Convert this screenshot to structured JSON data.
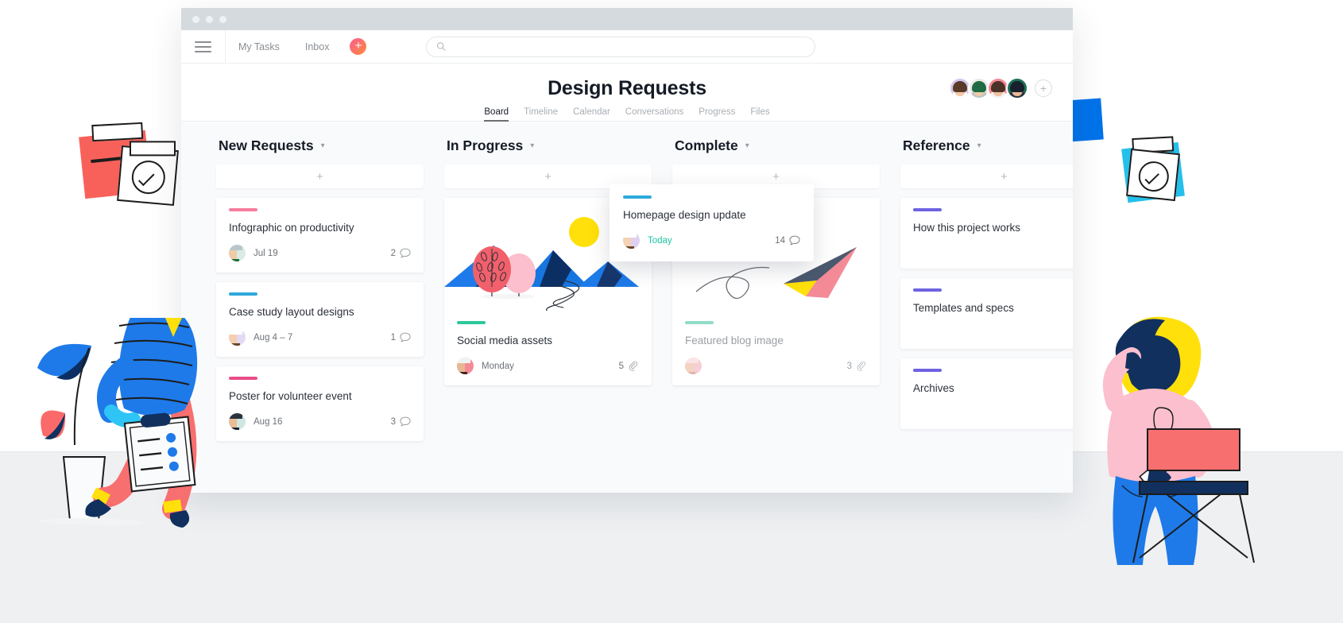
{
  "window": {
    "traffic_lights": 3,
    "topbar": {
      "menu_icon": "hamburger-icon",
      "nav": [
        {
          "label": "My Tasks"
        },
        {
          "label": "Inbox"
        }
      ],
      "add_button_label": "+",
      "search": {
        "placeholder": "",
        "value": "",
        "icon": "search-icon"
      }
    }
  },
  "project": {
    "title": "Design Requests",
    "tabs": [
      {
        "label": "Board",
        "active": true
      },
      {
        "label": "Timeline",
        "active": false
      },
      {
        "label": "Calendar",
        "active": false
      },
      {
        "label": "Conversations",
        "active": false
      },
      {
        "label": "Progress",
        "active": false
      },
      {
        "label": "Files",
        "active": false
      }
    ],
    "members": [
      {
        "name": "member-1",
        "ring": "#d5c6f0",
        "hair": "#5a3a28",
        "skin": "#f3c9a9",
        "body": "#ffffff"
      },
      {
        "name": "member-2",
        "ring": "#eceae3",
        "hair": "#1f6b44",
        "skin": "#f0cba8",
        "body": "#b8c4c9"
      },
      {
        "name": "member-3",
        "ring": "#f58a97",
        "hair": "#4a3326",
        "skin": "#efc3a2",
        "body": "#f3f4f6"
      },
      {
        "name": "member-4",
        "ring": "#1d6f57",
        "hair": "#18202b",
        "skin": "#e8b896",
        "body": "#2a3340"
      }
    ],
    "add_member_label": "+"
  },
  "board": {
    "add_card_label": "+",
    "columns": [
      {
        "title": "New Requests",
        "chevron": "chevron-down-icon",
        "cards": [
          {
            "title": "Infographic on productivity",
            "tag_color": "#f67d9d",
            "date": "Jul 19",
            "date_style": "normal",
            "meta_count": "2",
            "meta_icon": "comment-icon",
            "avatar": {
              "ring": "#d8ece4",
              "hair": "#1d6b3e",
              "skin": "#f0cba8",
              "body": "#b9c6cb"
            }
          },
          {
            "title": "Case study layout designs",
            "tag_color": "#2eaadc",
            "date": "Aug 4 – 7",
            "date_style": "normal",
            "meta_count": "1",
            "meta_icon": "comment-icon",
            "avatar": {
              "ring": "#e4d9f5",
              "hair": "#6b4423",
              "skin": "#f5cfaf",
              "body": "#ffffff"
            }
          },
          {
            "title": "Poster for volunteer event",
            "tag_color": "#ea4c89",
            "date": "Aug 16",
            "date_style": "normal",
            "meta_count": "3",
            "meta_icon": "comment-icon",
            "avatar": {
              "ring": "#cfe6e1",
              "hair": "#17202b",
              "skin": "#e9bd95",
              "body": "#2b3240"
            }
          }
        ]
      },
      {
        "title": "In Progress",
        "chevron": "chevron-down-icon",
        "cards": [
          {
            "title": "Social media assets",
            "tag_color": "#2dc79b",
            "date": "Monday",
            "date_style": "normal",
            "meta_count": "5",
            "meta_icon": "attachment-icon",
            "has_image": true,
            "image_name": "mountain-landscape-illustration",
            "avatar": {
              "ring": "#f58a97",
              "hair": "#3a2418",
              "skin": "#e8b793",
              "body": "#f1f2f4"
            }
          }
        ]
      },
      {
        "title": "Complete",
        "chevron": "chevron-down-icon",
        "cards": [
          {
            "title": "Featured blog image",
            "tag_color": "#8fdcc8",
            "date": "",
            "date_style": "normal",
            "meta_count": "3",
            "meta_icon": "attachment-icon",
            "has_image": true,
            "image_name": "paper-plane-illustration",
            "avatar": {
              "ring": "#f6cfd4",
              "hair": "#c08a7a",
              "skin": "#f3d4c0",
              "body": "#fae4e6"
            }
          }
        ]
      },
      {
        "title": "Reference",
        "chevron": "chevron-down-icon",
        "cards": [
          {
            "title": "How this project works",
            "tag_color": "#6e63e3",
            "date": "",
            "date_style": "normal",
            "meta_count": "",
            "meta_icon": ""
          },
          {
            "title": "Templates and specs",
            "tag_color": "#6e63e3",
            "date": "",
            "date_style": "normal",
            "meta_count": "",
            "meta_icon": ""
          },
          {
            "title": "Archives",
            "tag_color": "#6e63e3",
            "date": "",
            "date_style": "normal",
            "meta_count": "",
            "meta_icon": ""
          }
        ]
      }
    ]
  },
  "dragged_card": {
    "title": "Homepage design update",
    "tag_color": "#2eaadc",
    "date": "Today",
    "date_style": "today",
    "meta_count": "14",
    "meta_icon": "comment-icon",
    "avatar": {
      "ring": "#ded0f2",
      "hair": "#6a4526",
      "skin": "#f6d2b2",
      "body": "#ffffff"
    }
  },
  "decor": {
    "sticky_note_red": "sticky-note-red",
    "sticky_note_white_check": "sticky-note-white-checkmark",
    "sticky_note_blue": "sticky-note-blue",
    "sticky_note_cyan_check": "sticky-note-cyan-checkmark",
    "person_left": "person-with-clipboard-illustration",
    "person_right": "person-with-marker-illustration",
    "plant": "potted-plant-illustration",
    "chair": "chair-illustration"
  },
  "colors": {
    "accent_pink": "#f95d8f",
    "accent_orange": "#ff8a3d",
    "teal": "#1ec6a4",
    "blue": "#2eaadc",
    "purple": "#6e63e3",
    "page_bg": "#ffffff",
    "board_bg": "#f9fafb",
    "floor_bg": "#eef0f2"
  }
}
